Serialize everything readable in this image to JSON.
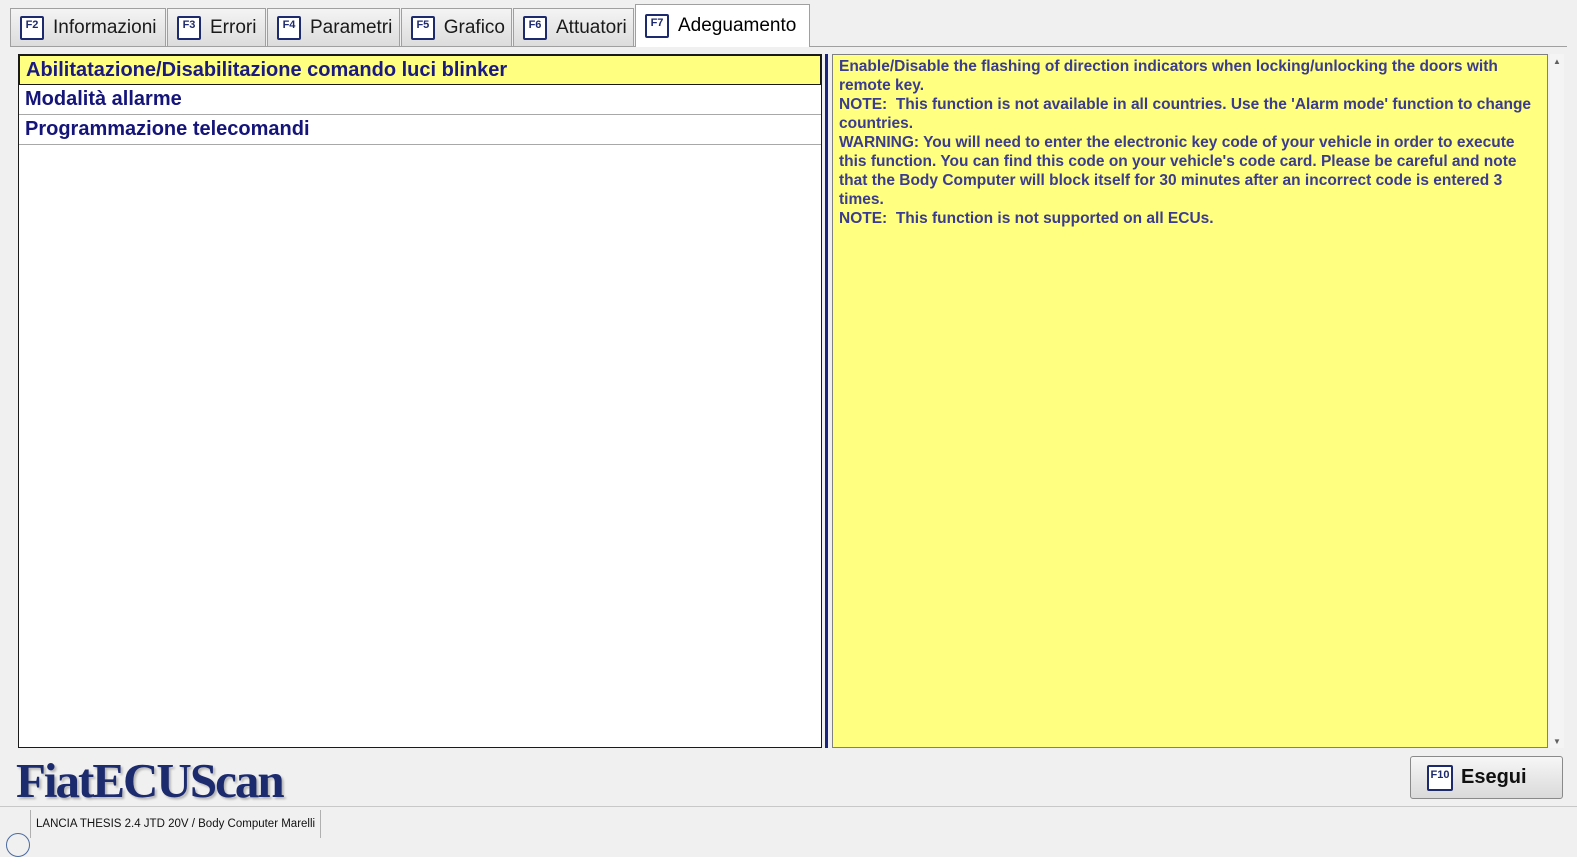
{
  "tabs": [
    {
      "key": "F2",
      "label": "Informazioni"
    },
    {
      "key": "F3",
      "label": "Errori"
    },
    {
      "key": "F4",
      "label": "Parametri"
    },
    {
      "key": "F5",
      "label": "Grafico"
    },
    {
      "key": "F6",
      "label": "Attuatori"
    },
    {
      "key": "F7",
      "label": "Adeguamento"
    }
  ],
  "active_tab": "Adeguamento",
  "list": {
    "items": [
      {
        "label": "Abilitatazione/Disabilitazione comando luci blinker"
      },
      {
        "label": "Modalità allarme"
      },
      {
        "label": "Programmazione telecomandi"
      }
    ],
    "selected": "Abilitatazione/Disabilitazione comando luci blinker"
  },
  "description": {
    "lines": [
      "Enable/Disable the flashing of direction indicators when locking/unlocking the doors with remote key.",
      "NOTE:  This function is not available in all countries. Use the 'Alarm mode' function to change countries.",
      "WARNING: You will need to enter the electronic key code of your vehicle in order to execute this function. You can find this code on your vehicle's code card. Please be careful and note that the Body Computer will block itself for 30 minutes after an incorrect code is entered 3 times.",
      "NOTE:  This function is not supported on all ECUs."
    ]
  },
  "logo": {
    "text": "FiatECUScan"
  },
  "execute_button": {
    "key": "F10",
    "label": "Esegui"
  },
  "status_bar": {
    "vehicle": "LANCIA THESIS 2.4 JTD 20V / Body Computer Marelli"
  },
  "colors": {
    "highlight": "#ffff80",
    "list_text": "#14147a",
    "desc_text": "#3b3b8f",
    "logo": "#1c2a6e"
  }
}
